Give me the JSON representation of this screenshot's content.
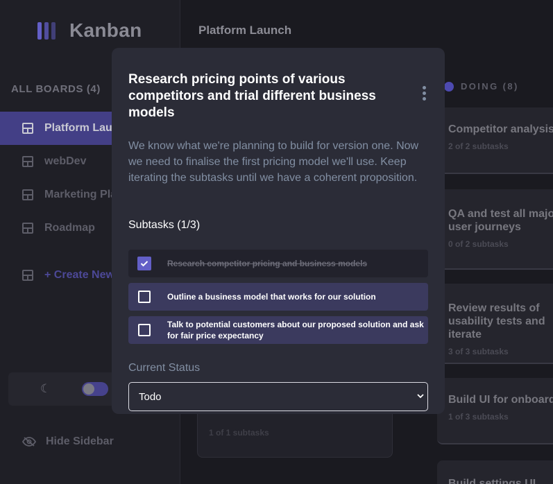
{
  "app": {
    "name": "Kanban"
  },
  "sidebar": {
    "boards_heading": "ALL BOARDS (4)",
    "boards": [
      {
        "label": "Platform Launch",
        "active": true
      },
      {
        "label": "webDev"
      },
      {
        "label": "Marketing Plan"
      },
      {
        "label": "Roadmap"
      }
    ],
    "create_label": "+ Create New Board",
    "hide_label": "Hide Sidebar"
  },
  "header": {
    "board_title": "Platform Launch"
  },
  "column": {
    "name": "DOING (8)",
    "color": "#8471f2"
  },
  "cards": [
    {
      "title": "Competitor analysis",
      "subtasks": "2 of 2 subtasks"
    },
    {
      "title": "QA and test all major user journeys",
      "subtasks": "0 of 2 subtasks"
    },
    {
      "title": "Review results of usability tests and iterate",
      "subtasks": "3 of 3 subtasks"
    },
    {
      "title": "Build UI for onboarding flow",
      "subtasks": "1 of 3 subtasks"
    },
    {
      "title": "Build settings UI"
    }
  ],
  "background_card": {
    "subtasks": "1 of 1 subtasks"
  },
  "modal": {
    "title": "Research pricing points of various competitors and trial different business models",
    "description": "We know what we're planning to build for version one. Now we need to finalise the first pricing model we'll use. Keep iterating the subtasks until we have a coherent proposition.",
    "subtasks_heading": "Subtasks (1/3)",
    "subtasks": [
      {
        "label": "Research competitor pricing and business models",
        "done": true
      },
      {
        "label": "Outline a business model that works for our solution",
        "done": false
      },
      {
        "label": "Talk to potential customers about our proposed solution and ask for fair price expectancy",
        "done": false
      }
    ],
    "status_label": "Current Status",
    "status_value": "Todo"
  },
  "colors": {
    "accent": "#635fc7",
    "modal_bg": "#2b2c37",
    "sidebar_bg": "#1f1f26"
  }
}
